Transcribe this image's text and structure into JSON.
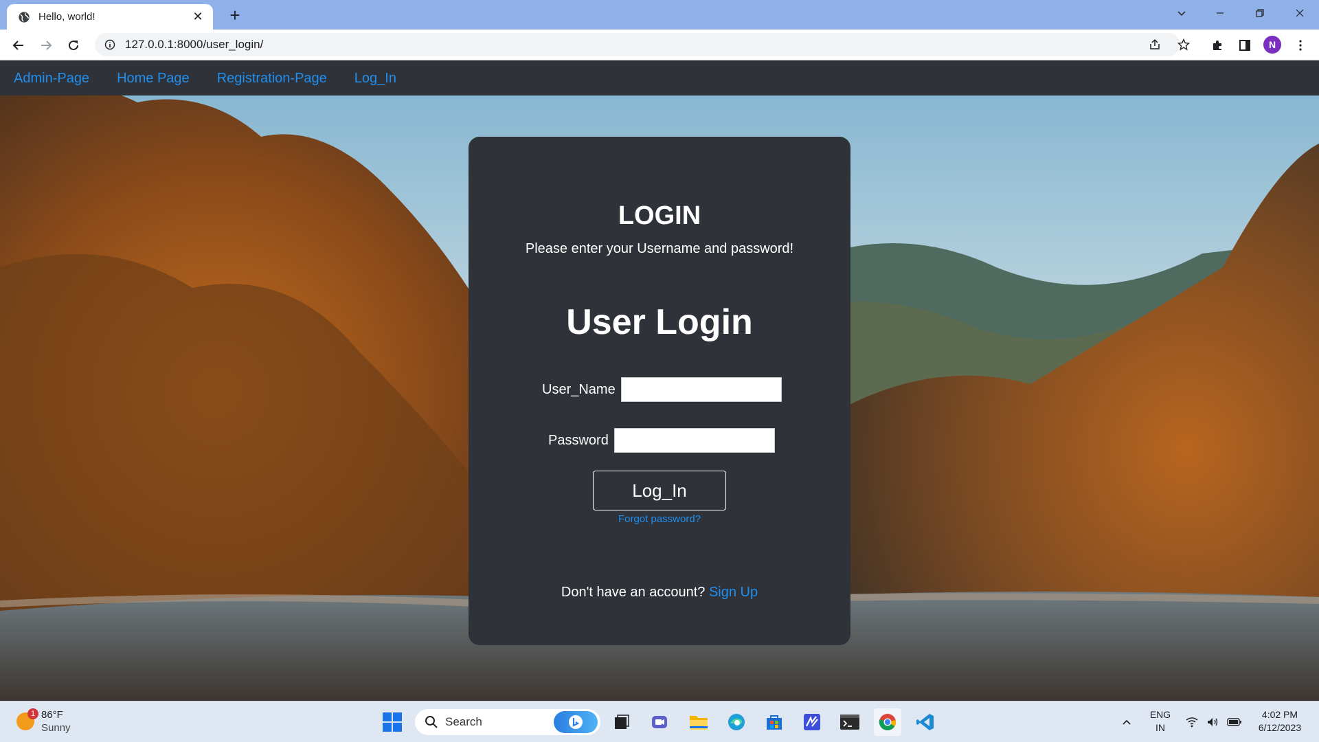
{
  "browser": {
    "tab_title": "Hello, world!",
    "new_tab": "+",
    "url": "127.0.0.1:8000/user_login/",
    "profile_initial": "N"
  },
  "site_nav": {
    "links": [
      "Admin-Page",
      "Home Page",
      "Registration-Page",
      "Log_In"
    ]
  },
  "login_card": {
    "heading": "LOGIN",
    "subtitle": "Please enter your Username and password!",
    "form_title": "User Login",
    "username_label": "User_Name",
    "username_value": "",
    "password_label": "Password",
    "password_value": "",
    "submit_label": "Log_In",
    "forgot_link": "Forgot password?",
    "signup_prompt": "Don't have an account?",
    "signup_link": "Sign Up"
  },
  "taskbar": {
    "weather_badge": "1",
    "temperature": "86°F",
    "condition": "Sunny",
    "search_label": "Search",
    "language_top": "ENG",
    "language_bottom": "IN",
    "time": "4:02 PM",
    "date": "6/12/2023"
  },
  "colors": {
    "tabbar": "#8fb0e8",
    "site_nav_bg": "#2f3238",
    "link_blue": "#1f8ff0",
    "card_bg": "#2f3238"
  }
}
